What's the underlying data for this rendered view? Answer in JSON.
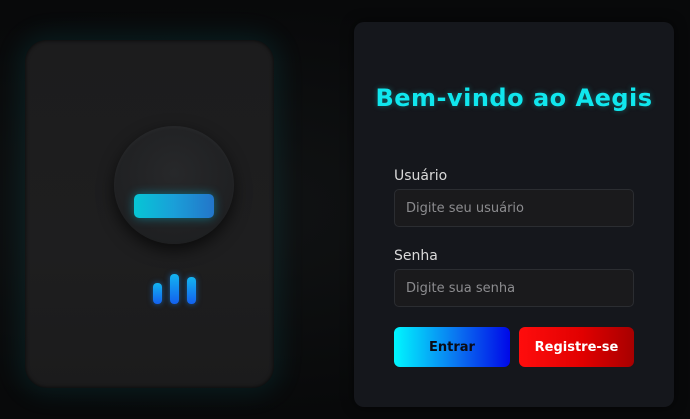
{
  "device": {
    "scanner_icon": "fingerprint-scanner-icon",
    "signal_icon": "signal-bars-icon",
    "signal_levels": [
      0.7,
      1.0,
      0.9
    ],
    "scanner_color": "#06c6d6",
    "signal_color": "#1360ee"
  },
  "login": {
    "title": "Bem-vindo ao Aegis",
    "username_label": "Usuário",
    "username_placeholder": "Digite seu usuário",
    "password_label": "Senha",
    "password_placeholder": "Digite sua senha",
    "login_button": "Entrar",
    "register_button": "Registre-se"
  },
  "colors": {
    "accent": "#10e7ee",
    "login_gradient_start": "#00f7ff",
    "login_gradient_end": "#0008e8",
    "register_gradient_start": "#ff0d0d",
    "register_gradient_end": "#a70000",
    "panel_background": "#15171c"
  }
}
